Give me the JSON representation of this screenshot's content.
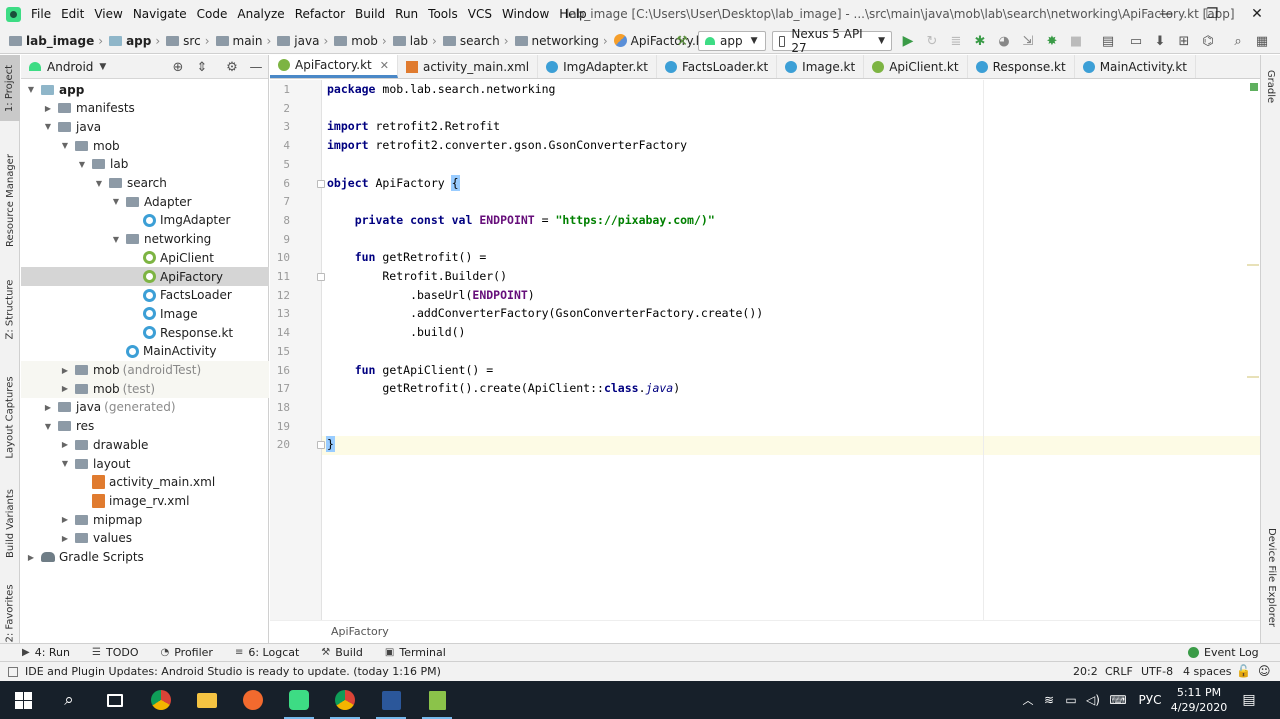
{
  "menu": {
    "items": [
      "File",
      "Edit",
      "View",
      "Navigate",
      "Code",
      "Analyze",
      "Refactor",
      "Build",
      "Run",
      "Tools",
      "VCS",
      "Window",
      "Help"
    ],
    "window_title": "lab_image [C:\\Users\\User\\Desktop\\lab_image] - ...\\src\\main\\java\\mob\\lab\\search\\networking\\ApiFactory.kt [app]"
  },
  "window_controls": {
    "minimize": "—",
    "restore": "❐",
    "close": "✕"
  },
  "breadcrumbs": [
    "lab_image",
    "app",
    "src",
    "main",
    "java",
    "mob",
    "lab",
    "search",
    "networking",
    "ApiFactory.kt"
  ],
  "toolbar": {
    "run_config": "app",
    "device": "Nexus 5 API 27"
  },
  "left_tabs": [
    "1: Project",
    "Resource Manager",
    "Z: Structure",
    "Layout Captures",
    "Build Variants",
    "2: Favorites"
  ],
  "right_tabs": [
    "Gradle",
    "Device File Explorer"
  ],
  "project_panel": {
    "view": "Android",
    "tree": [
      {
        "label": "app",
        "hint": "",
        "depth": 0,
        "icon": "folder-app",
        "expanded": true,
        "bold": true
      },
      {
        "label": "manifests",
        "hint": "",
        "depth": 1,
        "icon": "folder",
        "expanded": false
      },
      {
        "label": "java",
        "hint": "",
        "depth": 1,
        "icon": "folder",
        "expanded": true
      },
      {
        "label": "mob",
        "hint": "",
        "depth": 2,
        "icon": "package",
        "expanded": true
      },
      {
        "label": "lab",
        "hint": "",
        "depth": 3,
        "icon": "package",
        "expanded": true
      },
      {
        "label": "search",
        "hint": "",
        "depth": 4,
        "icon": "package",
        "expanded": true
      },
      {
        "label": "Adapter",
        "hint": "",
        "depth": 5,
        "icon": "package",
        "expanded": true
      },
      {
        "label": "ImgAdapter",
        "hint": "",
        "depth": 6,
        "icon": "kotlin-class",
        "leaf": true
      },
      {
        "label": "networking",
        "hint": "",
        "depth": 5,
        "icon": "package",
        "expanded": true
      },
      {
        "label": "ApiClient",
        "hint": "",
        "depth": 6,
        "icon": "kotlin-object",
        "leaf": true
      },
      {
        "label": "ApiFactory",
        "hint": "",
        "depth": 6,
        "icon": "kotlin-object",
        "leaf": true,
        "selected": true
      },
      {
        "label": "FactsLoader",
        "hint": "",
        "depth": 6,
        "icon": "kotlin-class",
        "leaf": true
      },
      {
        "label": "Image",
        "hint": "",
        "depth": 6,
        "icon": "kotlin-class",
        "leaf": true
      },
      {
        "label": "Response.kt",
        "hint": "",
        "depth": 6,
        "icon": "kotlin-class",
        "leaf": true
      },
      {
        "label": "MainActivity",
        "hint": "",
        "depth": 5,
        "icon": "kotlin-class",
        "leaf": true
      },
      {
        "label": "mob",
        "hint": "(androidTest)",
        "depth": 2,
        "icon": "package",
        "expanded": false,
        "shaded": true
      },
      {
        "label": "mob",
        "hint": "(test)",
        "depth": 2,
        "icon": "package",
        "expanded": false,
        "shaded": true
      },
      {
        "label": "java",
        "hint": "(generated)",
        "depth": 1,
        "icon": "folder",
        "expanded": false
      },
      {
        "label": "res",
        "hint": "",
        "depth": 1,
        "icon": "folder",
        "expanded": true
      },
      {
        "label": "drawable",
        "hint": "",
        "depth": 2,
        "icon": "folder",
        "expanded": false
      },
      {
        "label": "layout",
        "hint": "",
        "depth": 2,
        "icon": "folder",
        "expanded": true
      },
      {
        "label": "activity_main.xml",
        "hint": "",
        "depth": 3,
        "icon": "xml",
        "leaf": true
      },
      {
        "label": "image_rv.xml",
        "hint": "",
        "depth": 3,
        "icon": "xml",
        "leaf": true
      },
      {
        "label": "mipmap",
        "hint": "",
        "depth": 2,
        "icon": "folder",
        "expanded": false
      },
      {
        "label": "values",
        "hint": "",
        "depth": 2,
        "icon": "folder",
        "expanded": false
      },
      {
        "label": "Gradle Scripts",
        "hint": "",
        "depth": 0,
        "icon": "gradle",
        "expanded": false
      }
    ]
  },
  "editor_tabs": [
    {
      "label": "ApiFactory.kt",
      "icon": "kotlin-object",
      "active": true
    },
    {
      "label": "activity_main.xml",
      "icon": "xml"
    },
    {
      "label": "ImgAdapter.kt",
      "icon": "kotlin-class"
    },
    {
      "label": "FactsLoader.kt",
      "icon": "kotlin-class"
    },
    {
      "label": "Image.kt",
      "icon": "kotlin-class"
    },
    {
      "label": "ApiClient.kt",
      "icon": "kotlin-object"
    },
    {
      "label": "Response.kt",
      "icon": "kotlin-class"
    },
    {
      "label": "MainActivity.kt",
      "icon": "kotlin-class"
    }
  ],
  "code": {
    "lines": [
      [
        {
          "t": "package ",
          "c": "kw"
        },
        {
          "t": "mob.lab.search.networking",
          "c": ""
        }
      ],
      [],
      [
        {
          "t": "import ",
          "c": "kw"
        },
        {
          "t": "retrofit2.Retrofit",
          "c": ""
        }
      ],
      [
        {
          "t": "import ",
          "c": "kw"
        },
        {
          "t": "retrofit2.converter.gson.GsonConverterFactory",
          "c": ""
        }
      ],
      [],
      [
        {
          "t": "object ",
          "c": "kw"
        },
        {
          "t": "ApiFactory ",
          "c": ""
        },
        {
          "t": "{",
          "c": "brace"
        }
      ],
      [],
      [
        {
          "t": "    private const val ",
          "c": "kw"
        },
        {
          "t": "ENDPOINT",
          "c": "const"
        },
        {
          "t": " = ",
          "c": ""
        },
        {
          "t": "\"https://pixabay.com/)\"",
          "c": "str"
        }
      ],
      [],
      [
        {
          "t": "    fun ",
          "c": "kw"
        },
        {
          "t": "getRetrofit() =",
          "c": ""
        }
      ],
      [
        {
          "t": "        Retrofit.Builder()",
          "c": ""
        }
      ],
      [
        {
          "t": "            .baseUrl(",
          "c": ""
        },
        {
          "t": "ENDPOINT",
          "c": "const"
        },
        {
          "t": ")",
          "c": ""
        }
      ],
      [
        {
          "t": "            .addConverterFactory(GsonConverterFactory.create())",
          "c": ""
        }
      ],
      [
        {
          "t": "            .build()",
          "c": ""
        }
      ],
      [],
      [
        {
          "t": "    fun ",
          "c": "kw"
        },
        {
          "t": "getApiClient() =",
          "c": ""
        }
      ],
      [
        {
          "t": "        getRetrofit().create(ApiClient::",
          "c": ""
        },
        {
          "t": "class",
          "c": "kw"
        },
        {
          "t": ".",
          "c": ""
        },
        {
          "t": "java",
          "c": "it"
        },
        {
          "t": ")",
          "c": ""
        }
      ],
      [],
      [],
      [
        {
          "t": "}",
          "c": "brace"
        }
      ]
    ],
    "current_line": 20
  },
  "editor_breadcrumb": "ApiFactory",
  "bottom_tools": [
    {
      "icon": "▶",
      "label": "4: Run"
    },
    {
      "icon": "☰",
      "label": "TODO"
    },
    {
      "icon": "◔",
      "label": "Profiler"
    },
    {
      "icon": "≡",
      "label": "6: Logcat"
    },
    {
      "icon": "⚒",
      "label": "Build"
    },
    {
      "icon": "▣",
      "label": "Terminal"
    }
  ],
  "event_log": "Event Log",
  "status": {
    "message": "IDE and Plugin Updates: Android Studio is ready to update. (today 1:16 PM)",
    "position": "20:2",
    "line_sep": "CRLF",
    "encoding": "UTF-8",
    "indent": "4 spaces"
  },
  "taskbar": {
    "lang": "РУС",
    "time": "5:11 PM",
    "date": "4/29/2020"
  },
  "colors": {
    "accent": "#4a88c7",
    "keyword": "#000080",
    "string": "#008000",
    "constant": "#660e7a",
    "taskbar": "#17202a"
  }
}
